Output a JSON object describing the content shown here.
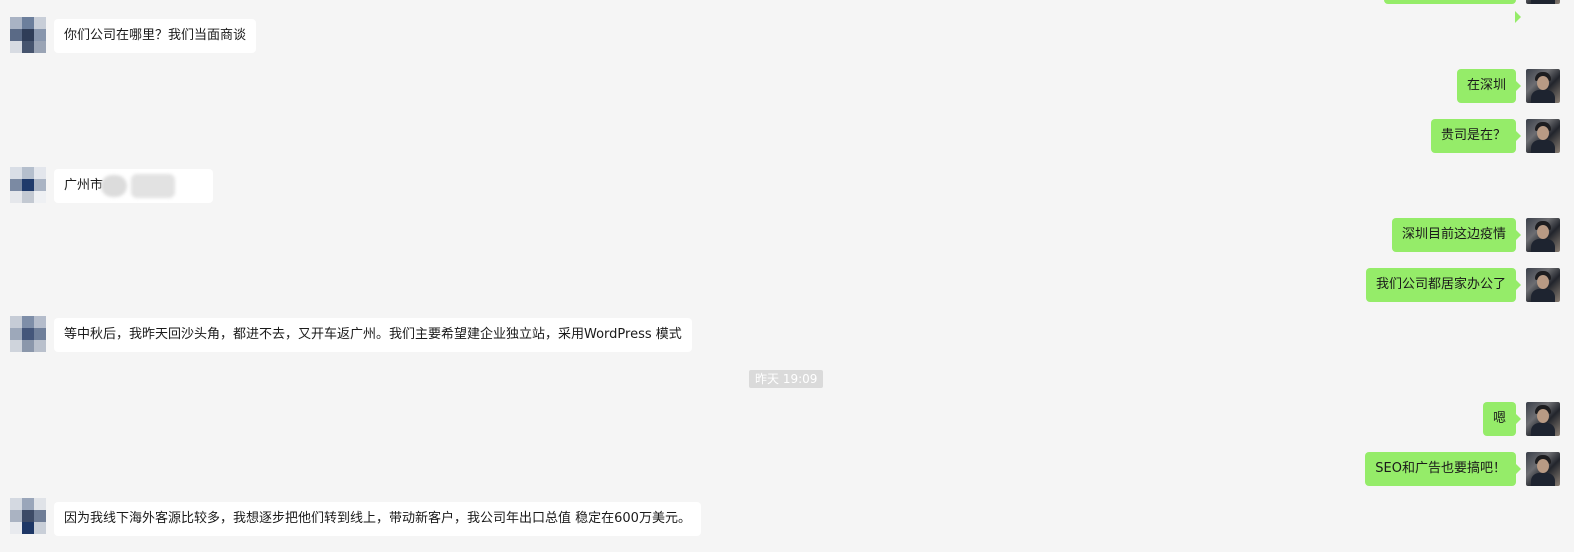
{
  "chat": {
    "timestamp": "昨天 19:09",
    "messages": [
      {
        "side": "in",
        "text": "你们公司在哪里？我们当面商谈"
      },
      {
        "side": "out",
        "text": "在深圳"
      },
      {
        "side": "out",
        "text": "贵司是在？"
      },
      {
        "side": "in",
        "text": "广州市",
        "redacted": true
      },
      {
        "side": "out",
        "text": "深圳目前这边疫情"
      },
      {
        "side": "out",
        "text": "我们公司都居家办公了"
      },
      {
        "side": "in",
        "text": "等中秋后，我昨天回沙头角，都进不去，又开车返广州。我们主要希望建企业独立站，采用WordPress 模式"
      },
      {
        "side": "out",
        "text": "嗯"
      },
      {
        "side": "out",
        "text": "SEO和广告也要搞吧！"
      },
      {
        "side": "in",
        "text": "因为我线下海外客源比较多，我想逐步把他们转到线上，带动新客户，我公司年出口总值 稳定在600万美元。"
      }
    ]
  },
  "colors": {
    "background": "#f5f5f5",
    "incoming_bubble": "#ffffff",
    "outgoing_bubble": "#95ec69",
    "timestamp_bg": "#dadada"
  },
  "icons": {
    "contact_avatar": "pixelated-avatar",
    "self_avatar": "user-photo-avatar"
  }
}
